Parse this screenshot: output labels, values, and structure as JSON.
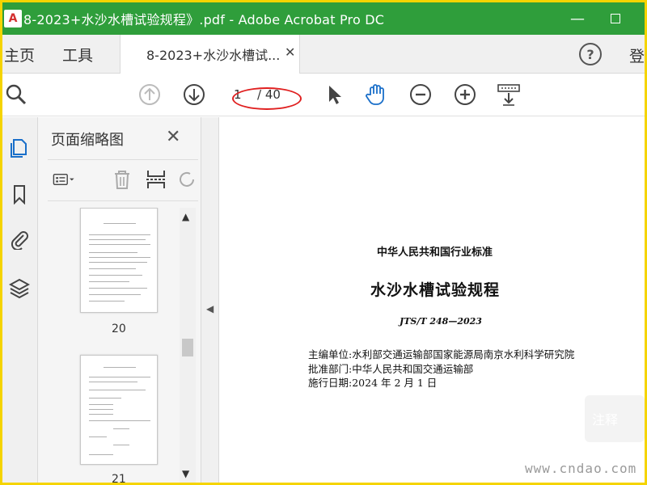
{
  "window": {
    "title": "8-2023+水沙水槽试验规程》.pdf - Adobe Acrobat Pro DC",
    "app_icon": "acrobat-icon"
  },
  "tabs": {
    "home": "主页",
    "tools": "工具",
    "document": "8-2023+水沙水槽试...",
    "login": "登"
  },
  "toolbar": {
    "page_current": "1",
    "page_total": "/ 40",
    "annotation_color": "#e02020"
  },
  "thumbnail_panel": {
    "title": "页面缩略图",
    "pages": [
      {
        "number": "20"
      },
      {
        "number": "21"
      }
    ]
  },
  "document": {
    "heading": "中华人民共和国行业标准",
    "title": "水沙水槽试验规程",
    "code": "JTS/T 248—2023",
    "meta": [
      "主编单位:水利部交通运输部国家能源局南京水利科学研究院",
      "批准部门:中华人民共和国交通运输部",
      "施行日期:2024 年 2 月 1 日"
    ]
  },
  "comment_button": "注释",
  "watermark": "www.cndao.com",
  "colors": {
    "titlebar": "#2f9e3b",
    "frame": "#f5d400"
  }
}
